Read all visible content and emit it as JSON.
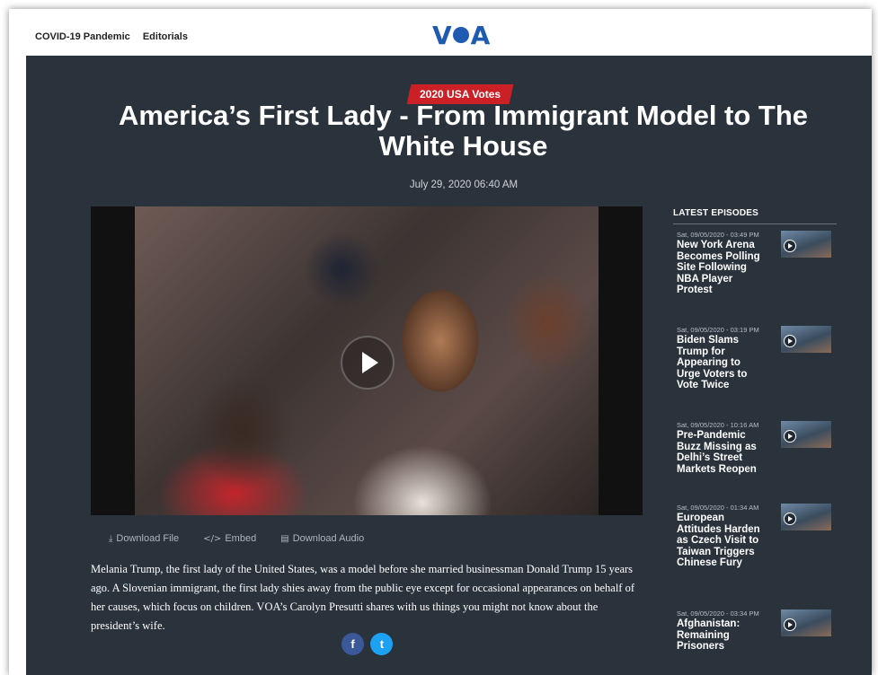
{
  "nav": {
    "items": [
      "COVID-19 Pandemic",
      "Editorials"
    ],
    "logo_text": "VOA"
  },
  "article": {
    "category": "2020 USA Votes",
    "title": "America’s First Lady - From Immigrant Model to The White House",
    "date": "July 29, 2020 06:40 AM",
    "actions": [
      {
        "icon": "download-icon",
        "label": "Download File"
      },
      {
        "icon": "embed-icon",
        "label": "Embed"
      },
      {
        "icon": "audio-file-icon",
        "label": "Download Audio"
      }
    ],
    "description": "Melania Trump, the first lady of the United States, was a model before she married businessman Donald Trump 15 years ago. A Slovenian immigrant, the first lady shies away from the public eye except for occasional appearances on behalf of her causes, which focus on children. VOA’s Carolyn Presutti shares with us things you might not know about the president’s wife.",
    "social": [
      "f",
      "t"
    ]
  },
  "sidebar": {
    "heading": "LATEST EPISODES",
    "episodes": [
      {
        "meta": "Sat, 09/05/2020 - 03:49 PM",
        "title": "New York Arena Becomes Polling Site Following NBA Player Protest"
      },
      {
        "meta": "Sat, 09/05/2020 - 03:19 PM",
        "title": "Biden Slams Trump for Appearing to Urge Voters to Vote Twice"
      },
      {
        "meta": "Sat, 09/05/2020 - 10:16 AM",
        "title": "Pre-Pandemic Buzz Missing as Delhi’s Street Markets Reopen"
      },
      {
        "meta": "Sat, 09/05/2020 - 01:34 AM",
        "title": "European Attitudes Harden as Czech Visit to Taiwan Triggers Chinese Fury"
      },
      {
        "meta": "Sat, 09/05/2020 - 03:34 PM",
        "title": "Afghanistan: Remaining Prisoners"
      }
    ]
  },
  "colors": {
    "brand": "#1f5bb0",
    "main_bg": "#2a323c",
    "badge": "#cc2027"
  }
}
